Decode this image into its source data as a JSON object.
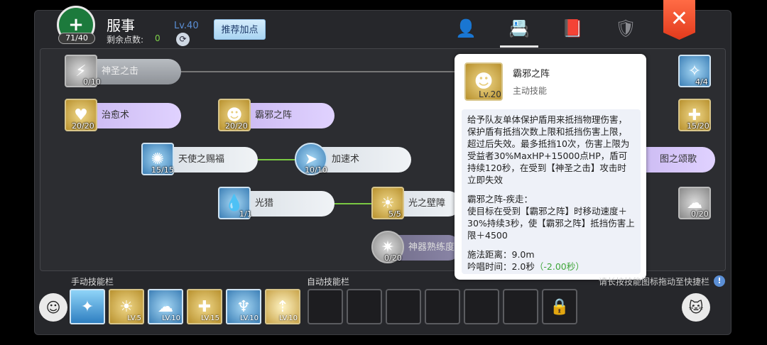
{
  "header": {
    "class_emblem": "+",
    "skill_points_used": "71/40",
    "class_name": "服事",
    "remaining_points_label": "剩余点数:",
    "remaining_points_value": "0",
    "player_level": "Lv.40",
    "recommend_button": "推荐加点",
    "close_icon": "✕"
  },
  "top_tabs": [
    {
      "icon": "👤",
      "name": "character"
    },
    {
      "icon": "📇",
      "name": "skill-book"
    },
    {
      "icon": "📕",
      "name": "codex"
    },
    {
      "icon": "🛡",
      "name": "guild"
    }
  ],
  "skills": [
    {
      "name": "神圣之击",
      "count": "0/10",
      "glyph": "⚡"
    },
    {
      "name": "治愈术",
      "count": "20/20",
      "glyph": "♥"
    },
    {
      "name": "霸邪之阵",
      "count": "20/20",
      "glyph": "☻"
    },
    {
      "name": "天使之赐福",
      "count": "15/15",
      "glyph": "✺"
    },
    {
      "name": "加速术",
      "count": "10/10",
      "glyph": "➤"
    },
    {
      "name": "光猎",
      "count": "1/1",
      "glyph": "💧"
    },
    {
      "name": "光之壁障",
      "count": "5/5",
      "glyph": "☀"
    },
    {
      "name": "神器熟练度",
      "count": "0/20",
      "glyph": "✷"
    },
    {
      "name": "",
      "count": "4/4",
      "glyph": "✧"
    },
    {
      "name": "",
      "count": "15/20",
      "glyph": "✚"
    },
    {
      "name": "图之颂歌",
      "count": "",
      "glyph": ""
    },
    {
      "name": "",
      "count": "0/20",
      "glyph": "☁"
    }
  ],
  "tooltip": {
    "icon": "☻",
    "level": "Lv.20",
    "name": "霸邪之阵",
    "type": "主动技能",
    "desc1": "给予队友单体保护盾用来抵挡物理伤害，保护盾有抵挡次数上限和抵挡伤害上限，超过后失效。最多抵挡10次，伤害上限为受益者30%MaxHP+15000点HP，盾可持续120秒，在受到【神圣之击】攻击时立即失效",
    "desc2": "霸邪之阵-疾走：\n使目标在受到【霸邪之阵】时移动速度＋30%持续3秒，使【霸邪之阵】抵挡伤害上限＋4500",
    "cast_distance": "施法距离：9.0m",
    "cast_time": "吟唱时间：2.0秒",
    "cast_time_bonus": "（-2.00秒）"
  },
  "bottom": {
    "manual_label": "手动技能栏",
    "auto_label": "自动技能栏",
    "hint": "请长按技能图标拖动至快捷栏",
    "hint_icon": "!",
    "left_avatar": "☺",
    "right_avatar": "🐱",
    "manual_slots": [
      {
        "glyph": "✦",
        "level": ""
      },
      {
        "glyph": "☀",
        "level": "LV.5"
      },
      {
        "glyph": "☁",
        "level": "LV.10"
      },
      {
        "glyph": "✚",
        "level": "LV.15"
      },
      {
        "glyph": "♆",
        "level": "LV.10"
      },
      {
        "glyph": "⇡",
        "level": "LV.10"
      }
    ],
    "lock_icon": "🔒"
  }
}
